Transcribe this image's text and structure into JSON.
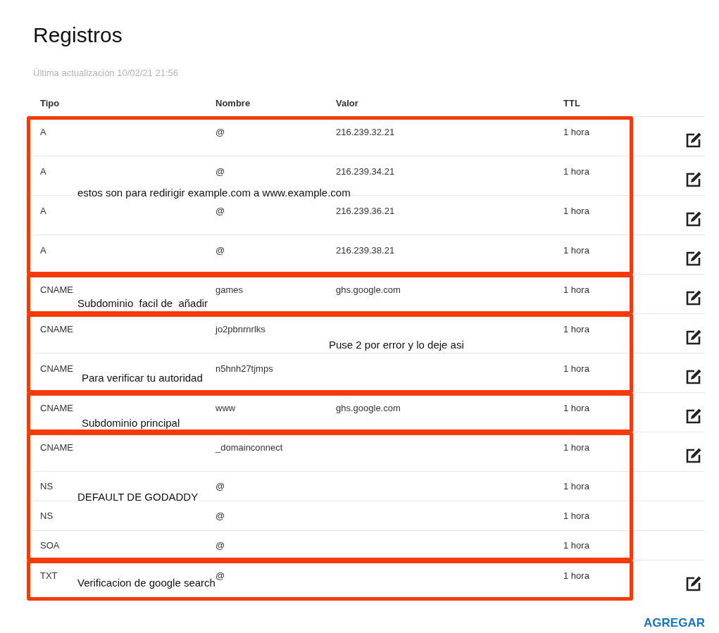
{
  "title": "Registros",
  "updated": "Última actualización 10/02/21 21:56",
  "table": {
    "columns": [
      "Tipo",
      "Nombre",
      "Valor",
      "TTL"
    ],
    "groups": [
      {
        "notes": [
          "estos son para redirigir example.com a www.example.com"
        ],
        "rows": [
          {
            "type": "A",
            "name": "@",
            "value": "216.239.32.21",
            "ttl": "1 hora",
            "editable": true
          },
          {
            "type": "A",
            "name": "@",
            "value": "216.239.34.21",
            "ttl": "1 hora",
            "editable": true
          },
          {
            "type": "A",
            "name": "@",
            "value": "216.239.36.21",
            "ttl": "1 hora",
            "editable": true
          },
          {
            "type": "A",
            "name": "@",
            "value": "216.239.38.21",
            "ttl": "1 hora",
            "editable": true
          }
        ]
      },
      {
        "notes": [
          "Subdominio  facil de  añadir"
        ],
        "rows": [
          {
            "type": "CNAME",
            "name": "games",
            "value": "ghs.google.com",
            "ttl": "1 hora",
            "editable": true
          }
        ]
      },
      {
        "notes": [
          "Puse 2 por error y lo deje asi",
          "Para verificar tu autoridad"
        ],
        "rows": [
          {
            "type": "CNAME",
            "name": "jo2pbnrnrlks",
            "ttl": "1 hora",
            "editable": true
          },
          {
            "type": "CNAME",
            "name": "n5hnh27tjmps",
            "ttl": "1 hora",
            "editable": true
          }
        ]
      },
      {
        "notes": [
          "Subdominio principal"
        ],
        "rows": [
          {
            "type": "CNAME",
            "name": "www",
            "value": "ghs.google.com",
            "ttl": "1 hora",
            "editable": true
          }
        ]
      },
      {
        "notes": [
          "DEFAULT DE GODADDY"
        ],
        "rows": [
          {
            "type": "CNAME",
            "name": "_domainconnect",
            "ttl": "1 hora",
            "editable": true
          },
          {
            "type": "NS",
            "name": "@",
            "ttl": "1 hora",
            "editable": false
          },
          {
            "type": "NS",
            "name": "@",
            "ttl": "1 hora",
            "editable": false
          },
          {
            "type": "SOA",
            "name": "@",
            "ttl": "1 hora",
            "editable": false
          }
        ]
      },
      {
        "notes": [
          "Verificacion de google search"
        ],
        "rows": [
          {
            "type": "TXT",
            "name": "@",
            "ttl": "1 hora",
            "editable": true
          }
        ]
      }
    ]
  },
  "add_button": "AGREGAR"
}
